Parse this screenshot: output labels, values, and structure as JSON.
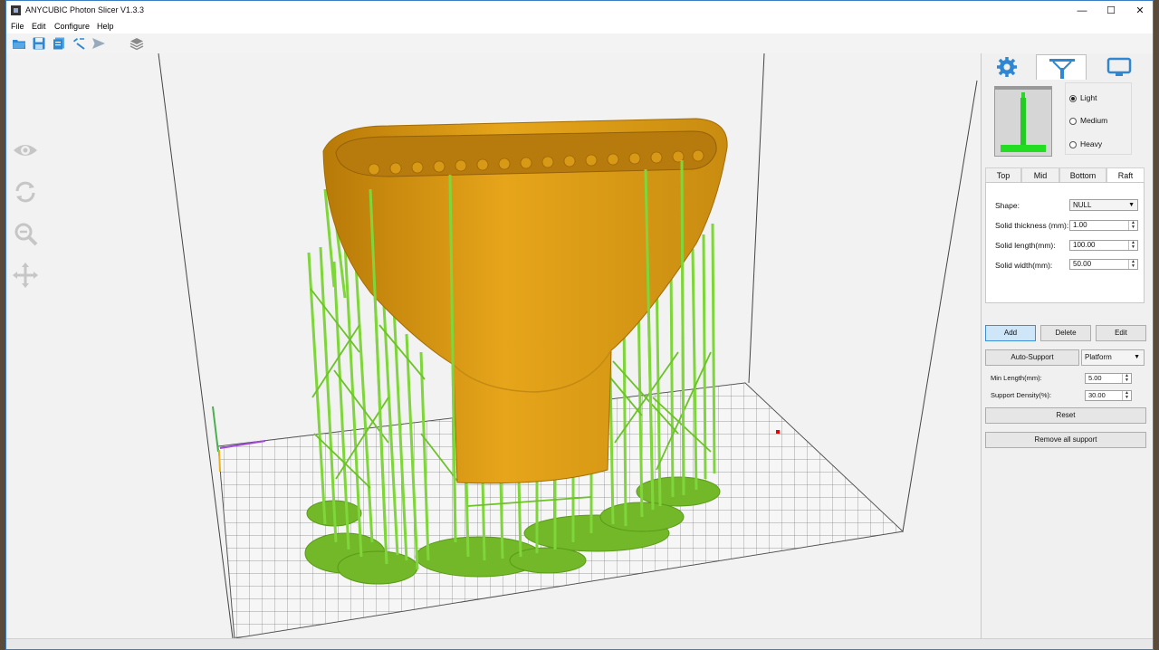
{
  "window": {
    "title": "ANYCUBIC Photon Slicer V1.3.3",
    "minimize": "—",
    "maximize": "☐",
    "close": "✕"
  },
  "menu": [
    "File",
    "Edit",
    "Configure",
    "Help"
  ],
  "toolbar": {
    "icons": [
      "open-folder-icon",
      "save-icon",
      "copy-icon",
      "slice-icon",
      "send-icon",
      "layers-icon"
    ]
  },
  "viewport_tools": [
    "eye-icon",
    "rotate-icon",
    "zoom-out-icon",
    "move-icon"
  ],
  "panel": {
    "tabs": [
      {
        "icon": "gear-icon",
        "active": false
      },
      {
        "icon": "support-icon",
        "active": true
      },
      {
        "icon": "monitor-icon",
        "active": false
      }
    ],
    "density": {
      "options": [
        "Light",
        "Medium",
        "Heavy"
      ],
      "selected": "Light"
    },
    "subtabs": {
      "items": [
        "Top",
        "Mid",
        "Bottom",
        "Raft"
      ],
      "active": "Raft"
    },
    "raft": {
      "shape_label": "Shape:",
      "shape_value": "NULL",
      "thickness_label": "Solid thickness (mm):",
      "thickness_value": "1.00",
      "length_label": "Solid length(mm):",
      "length_value": "100.00",
      "width_label": "Solid width(mm):",
      "width_value": "50.00"
    },
    "buttons": {
      "add": "Add",
      "delete": "Delete",
      "edit": "Edit"
    },
    "auto": {
      "button": "Auto-Support",
      "mode": "Platform",
      "min_length_label": "Min Length(mm):",
      "min_length_value": "5.00",
      "density_label": "Support Density(%):",
      "density_value": "30.00"
    },
    "reset": "Reset",
    "remove_all": "Remove all support"
  },
  "colors": {
    "model": "#e1a21a",
    "support": "#7fd63a",
    "accent": "#2f86d1"
  }
}
